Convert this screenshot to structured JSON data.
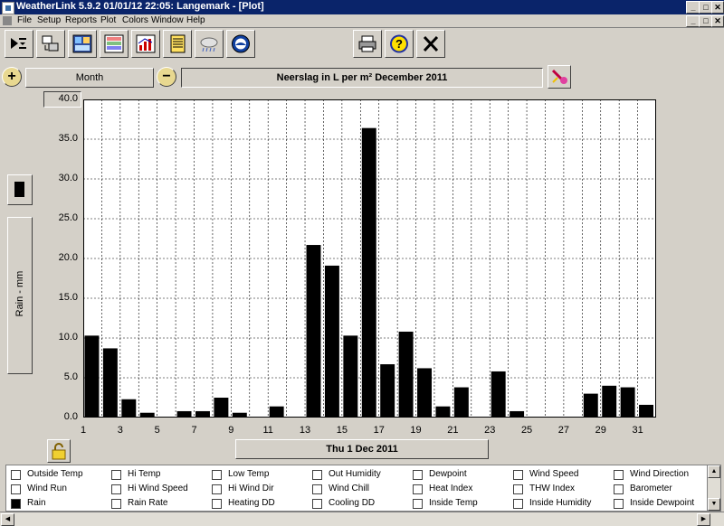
{
  "titlebar": {
    "title": "WeatherLink 5.9.2  01/01/12  22:05: Langemark - [Plot]"
  },
  "window_buttons": [
    "_",
    "□",
    "✕"
  ],
  "menu": [
    "File",
    "Setup",
    "Reports",
    "Plot",
    "Colors",
    "Window",
    "Help"
  ],
  "toolbar": {
    "icons": [
      "select-station-icon",
      "download-icon",
      "bulletin-icon",
      "strip-chart-icon",
      "plot-icon",
      "browse-icon",
      "weather-cloud-icon",
      "noaa-icon"
    ],
    "right_icons": [
      "print-icon",
      "help-icon",
      "close-icon"
    ]
  },
  "controls": {
    "zoom_in": "+",
    "period": "Month",
    "zoom_out": "−",
    "plot_title": "Neerslag in L per m²   December 2011",
    "date_label": "Thu 1 Dec 2011",
    "axis_label": "Rain - mm"
  },
  "colors": {
    "bar": "#000000",
    "plot_bg": "#ffffff",
    "grid": "#000000",
    "window": "#d4d0c8",
    "titlebar": "#0a246a"
  },
  "chart_data": {
    "type": "bar",
    "title": "Neerslag in L per m²   December 2011",
    "xlabel": "Thu 1 Dec 2011",
    "ylabel": "Rain - mm",
    "ylim": [
      0,
      40
    ],
    "yticks": [
      "0.0",
      "5.0",
      "10.0",
      "15.0",
      "20.0",
      "25.0",
      "30.0",
      "35.0",
      "40.0"
    ],
    "xticks": [
      1,
      3,
      5,
      7,
      9,
      11,
      13,
      15,
      17,
      19,
      21,
      23,
      25,
      27,
      29,
      31
    ],
    "x": [
      1,
      2,
      3,
      4,
      5,
      6,
      7,
      8,
      9,
      10,
      11,
      12,
      13,
      14,
      15,
      16,
      17,
      18,
      19,
      20,
      21,
      22,
      23,
      24,
      25,
      26,
      27,
      28,
      29,
      30,
      31
    ],
    "values": [
      10.3,
      8.7,
      2.3,
      0.6,
      0.1,
      0.8,
      0.8,
      2.5,
      0.6,
      0.1,
      1.4,
      0.0,
      21.7,
      19.1,
      10.3,
      36.4,
      6.7,
      10.8,
      6.2,
      1.4,
      3.8,
      0.0,
      5.8,
      0.8,
      0.1,
      0.1,
      0.1,
      3.0,
      4.0,
      3.8,
      1.6
    ],
    "grid": true
  },
  "checkboxes": [
    [
      {
        "label": "Outside Temp",
        "checked": false
      },
      {
        "label": "Hi Temp",
        "checked": false
      },
      {
        "label": "Low Temp",
        "checked": false
      },
      {
        "label": "Out Humidity",
        "checked": false
      },
      {
        "label": "Dewpoint",
        "checked": false
      },
      {
        "label": "Wind Speed",
        "checked": false
      },
      {
        "label": "Wind Direction",
        "checked": false
      }
    ],
    [
      {
        "label": "Wind Run",
        "checked": false
      },
      {
        "label": "Hi Wind Speed",
        "checked": false
      },
      {
        "label": "Hi Wind Dir",
        "checked": false
      },
      {
        "label": "Wind Chill",
        "checked": false
      },
      {
        "label": "Heat Index",
        "checked": false
      },
      {
        "label": "THW Index",
        "checked": false
      },
      {
        "label": "Barometer",
        "checked": false
      }
    ],
    [
      {
        "label": "Rain",
        "checked": true
      },
      {
        "label": "Rain Rate",
        "checked": false
      },
      {
        "label": "Heating DD",
        "checked": false
      },
      {
        "label": "Cooling DD",
        "checked": false
      },
      {
        "label": "Inside Temp",
        "checked": false
      },
      {
        "label": "Inside Humidity",
        "checked": false
      },
      {
        "label": "Inside Dewpoint",
        "checked": false
      }
    ]
  ]
}
